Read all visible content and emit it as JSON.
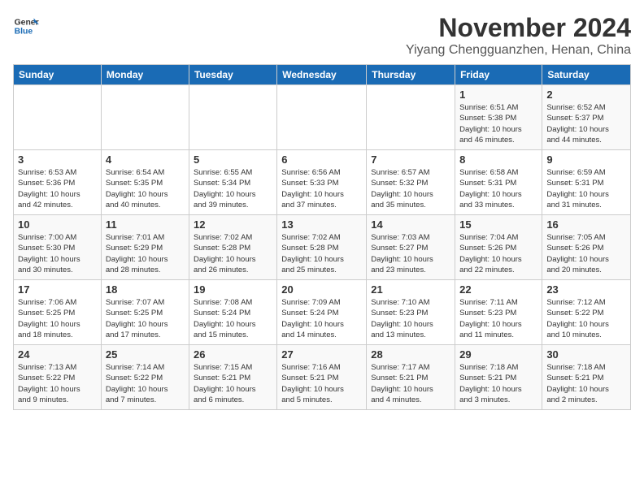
{
  "logo": {
    "line1": "General",
    "line2": "Blue"
  },
  "title": "November 2024",
  "location": "Yiyang Chengguanzhen, Henan, China",
  "headers": [
    "Sunday",
    "Monday",
    "Tuesday",
    "Wednesday",
    "Thursday",
    "Friday",
    "Saturday"
  ],
  "weeks": [
    [
      {
        "day": "",
        "info": ""
      },
      {
        "day": "",
        "info": ""
      },
      {
        "day": "",
        "info": ""
      },
      {
        "day": "",
        "info": ""
      },
      {
        "day": "",
        "info": ""
      },
      {
        "day": "1",
        "info": "Sunrise: 6:51 AM\nSunset: 5:38 PM\nDaylight: 10 hours\nand 46 minutes."
      },
      {
        "day": "2",
        "info": "Sunrise: 6:52 AM\nSunset: 5:37 PM\nDaylight: 10 hours\nand 44 minutes."
      }
    ],
    [
      {
        "day": "3",
        "info": "Sunrise: 6:53 AM\nSunset: 5:36 PM\nDaylight: 10 hours\nand 42 minutes."
      },
      {
        "day": "4",
        "info": "Sunrise: 6:54 AM\nSunset: 5:35 PM\nDaylight: 10 hours\nand 40 minutes."
      },
      {
        "day": "5",
        "info": "Sunrise: 6:55 AM\nSunset: 5:34 PM\nDaylight: 10 hours\nand 39 minutes."
      },
      {
        "day": "6",
        "info": "Sunrise: 6:56 AM\nSunset: 5:33 PM\nDaylight: 10 hours\nand 37 minutes."
      },
      {
        "day": "7",
        "info": "Sunrise: 6:57 AM\nSunset: 5:32 PM\nDaylight: 10 hours\nand 35 minutes."
      },
      {
        "day": "8",
        "info": "Sunrise: 6:58 AM\nSunset: 5:31 PM\nDaylight: 10 hours\nand 33 minutes."
      },
      {
        "day": "9",
        "info": "Sunrise: 6:59 AM\nSunset: 5:31 PM\nDaylight: 10 hours\nand 31 minutes."
      }
    ],
    [
      {
        "day": "10",
        "info": "Sunrise: 7:00 AM\nSunset: 5:30 PM\nDaylight: 10 hours\nand 30 minutes."
      },
      {
        "day": "11",
        "info": "Sunrise: 7:01 AM\nSunset: 5:29 PM\nDaylight: 10 hours\nand 28 minutes."
      },
      {
        "day": "12",
        "info": "Sunrise: 7:02 AM\nSunset: 5:28 PM\nDaylight: 10 hours\nand 26 minutes."
      },
      {
        "day": "13",
        "info": "Sunrise: 7:02 AM\nSunset: 5:28 PM\nDaylight: 10 hours\nand 25 minutes."
      },
      {
        "day": "14",
        "info": "Sunrise: 7:03 AM\nSunset: 5:27 PM\nDaylight: 10 hours\nand 23 minutes."
      },
      {
        "day": "15",
        "info": "Sunrise: 7:04 AM\nSunset: 5:26 PM\nDaylight: 10 hours\nand 22 minutes."
      },
      {
        "day": "16",
        "info": "Sunrise: 7:05 AM\nSunset: 5:26 PM\nDaylight: 10 hours\nand 20 minutes."
      }
    ],
    [
      {
        "day": "17",
        "info": "Sunrise: 7:06 AM\nSunset: 5:25 PM\nDaylight: 10 hours\nand 18 minutes."
      },
      {
        "day": "18",
        "info": "Sunrise: 7:07 AM\nSunset: 5:25 PM\nDaylight: 10 hours\nand 17 minutes."
      },
      {
        "day": "19",
        "info": "Sunrise: 7:08 AM\nSunset: 5:24 PM\nDaylight: 10 hours\nand 15 minutes."
      },
      {
        "day": "20",
        "info": "Sunrise: 7:09 AM\nSunset: 5:24 PM\nDaylight: 10 hours\nand 14 minutes."
      },
      {
        "day": "21",
        "info": "Sunrise: 7:10 AM\nSunset: 5:23 PM\nDaylight: 10 hours\nand 13 minutes."
      },
      {
        "day": "22",
        "info": "Sunrise: 7:11 AM\nSunset: 5:23 PM\nDaylight: 10 hours\nand 11 minutes."
      },
      {
        "day": "23",
        "info": "Sunrise: 7:12 AM\nSunset: 5:22 PM\nDaylight: 10 hours\nand 10 minutes."
      }
    ],
    [
      {
        "day": "24",
        "info": "Sunrise: 7:13 AM\nSunset: 5:22 PM\nDaylight: 10 hours\nand 9 minutes."
      },
      {
        "day": "25",
        "info": "Sunrise: 7:14 AM\nSunset: 5:22 PM\nDaylight: 10 hours\nand 7 minutes."
      },
      {
        "day": "26",
        "info": "Sunrise: 7:15 AM\nSunset: 5:21 PM\nDaylight: 10 hours\nand 6 minutes."
      },
      {
        "day": "27",
        "info": "Sunrise: 7:16 AM\nSunset: 5:21 PM\nDaylight: 10 hours\nand 5 minutes."
      },
      {
        "day": "28",
        "info": "Sunrise: 7:17 AM\nSunset: 5:21 PM\nDaylight: 10 hours\nand 4 minutes."
      },
      {
        "day": "29",
        "info": "Sunrise: 7:18 AM\nSunset: 5:21 PM\nDaylight: 10 hours\nand 3 minutes."
      },
      {
        "day": "30",
        "info": "Sunrise: 7:18 AM\nSunset: 5:21 PM\nDaylight: 10 hours\nand 2 minutes."
      }
    ]
  ]
}
